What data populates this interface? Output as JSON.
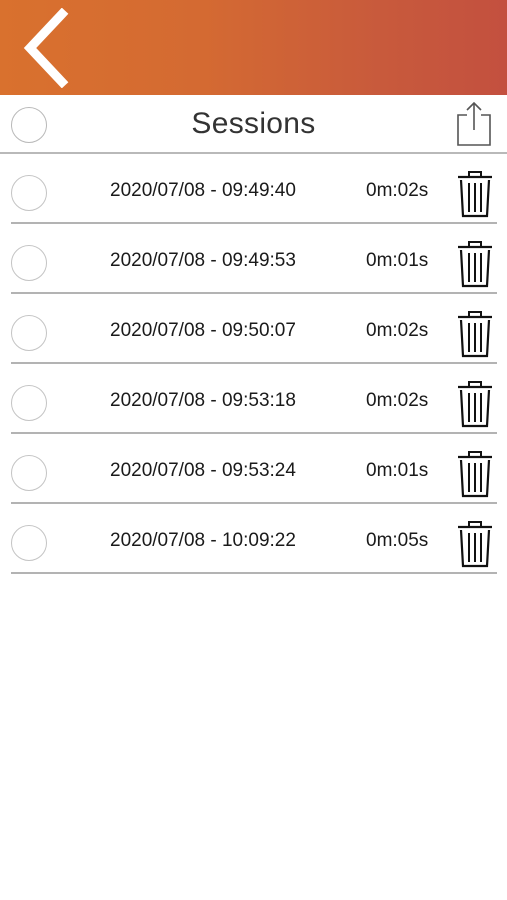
{
  "header": {
    "back_icon": "chevron-left-icon",
    "title": "Sessions",
    "share_icon": "share-icon",
    "gradient": [
      "#d9712e",
      "#c3503f"
    ]
  },
  "sessions": [
    {
      "timestamp": "2020/07/08 - 09:49:40",
      "duration": "0m:02s",
      "delete_icon": "trash-icon"
    },
    {
      "timestamp": "2020/07/08 - 09:49:53",
      "duration": "0m:01s",
      "delete_icon": "trash-icon"
    },
    {
      "timestamp": "2020/07/08 - 09:50:07",
      "duration": "0m:02s",
      "delete_icon": "trash-icon"
    },
    {
      "timestamp": "2020/07/08 - 09:53:18",
      "duration": "0m:02s",
      "delete_icon": "trash-icon"
    },
    {
      "timestamp": "2020/07/08 - 09:53:24",
      "duration": "0m:01s",
      "delete_icon": "trash-icon"
    },
    {
      "timestamp": "2020/07/08 - 10:09:22",
      "duration": "0m:05s",
      "delete_icon": "trash-icon"
    }
  ]
}
